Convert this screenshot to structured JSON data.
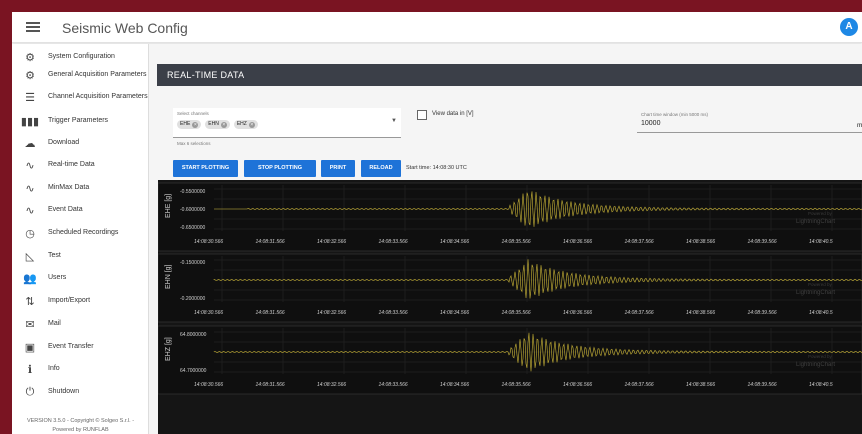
{
  "app": {
    "title": "Seismic Web Config",
    "avatar": "A"
  },
  "sidebar": {
    "items": [
      {
        "label": "System Configuration",
        "icon": "gear-icon",
        "glyph": "⚙"
      },
      {
        "label": "General Acquisition Parameters",
        "icon": "gear-icon",
        "glyph": "⚙"
      },
      {
        "label": "Channel Acquisition Parameters",
        "icon": "list-icon",
        "glyph": "☰"
      },
      {
        "label": "Trigger Parameters",
        "icon": "bars-icon",
        "glyph": "▮▮▮"
      },
      {
        "label": "Download",
        "icon": "cloud-download-icon",
        "glyph": "☁"
      },
      {
        "label": "Real-time Data",
        "icon": "wave-icon",
        "glyph": "∿"
      },
      {
        "label": "MinMax Data",
        "icon": "wave-icon",
        "glyph": "∿"
      },
      {
        "label": "Event Data",
        "icon": "wave-icon",
        "glyph": "∿"
      },
      {
        "label": "Scheduled Recordings",
        "icon": "clock-icon",
        "glyph": "◷"
      },
      {
        "label": "Test",
        "icon": "ruler-icon",
        "glyph": "◺"
      },
      {
        "label": "Users",
        "icon": "users-icon",
        "glyph": "👥"
      },
      {
        "label": "Import/Export",
        "icon": "import-export-icon",
        "glyph": "⇅"
      },
      {
        "label": "Mail",
        "icon": "mail-icon",
        "glyph": "✉"
      },
      {
        "label": "Event Transfer",
        "icon": "transfer-icon",
        "glyph": "▣"
      },
      {
        "label": "Info",
        "icon": "info-icon",
        "glyph": "ℹ"
      },
      {
        "label": "Shutdown",
        "icon": "power-icon",
        "glyph": "⏻"
      }
    ],
    "version_line1": "VERSION 3.5.0 - Copyright © Solgeo S.r.l. -",
    "version_line2": "Powered by RUNFLAB"
  },
  "main": {
    "section_title": "REAL-TIME DATA",
    "channels": {
      "label": "Select channels",
      "chips": [
        "EHE",
        "EHN",
        "EHZ"
      ],
      "hint": "Max 6 selections"
    },
    "view_data_label": "View data in [V]",
    "time_window": {
      "label": "Chart time window (min 5000 ms)",
      "value": "10000",
      "unit": "ms"
    },
    "buttons": {
      "start": "START PLOTTING",
      "stop": "STOP PLOTTING",
      "print": "PRINT",
      "reload": "RELOAD"
    },
    "start_time": "Start time: 14:08:30 UTC"
  },
  "charts": {
    "watermark": "LightningChart",
    "watermark_pre": "Powered by",
    "x_ticks": [
      "14:08:30.566",
      "14:08:31.566",
      "14:08:32.566",
      "14:08:33.566",
      "14:08:34.566",
      "14:08:35.566",
      "14:08:36.566",
      "14:08:37.566",
      "14:08:38.566",
      "14:08:39.566",
      "14:08:40.5"
    ],
    "panels": [
      {
        "ylabel": "EHE [g]",
        "y_ticks": [
          "-0.5500000",
          "-0.6000000",
          "-0.6500000"
        ],
        "color": "#c9b437"
      },
      {
        "ylabel": "EHN [g]",
        "y_ticks": [
          "-0.1500000",
          "-0.2000000"
        ],
        "color": "#c9b437"
      },
      {
        "ylabel": "EHZ [g]",
        "y_ticks": [
          "64.8000000",
          "64.7000000"
        ],
        "color": "#c9b437"
      }
    ]
  }
}
